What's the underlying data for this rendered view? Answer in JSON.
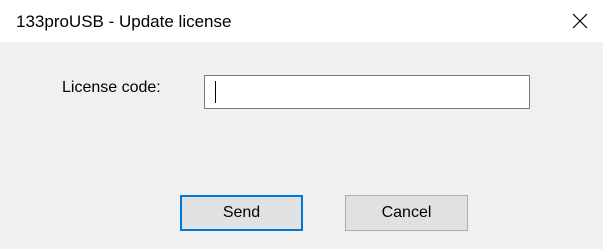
{
  "window": {
    "title": "133proUSB - Update license"
  },
  "form": {
    "license_label": "License code:",
    "license_value": "",
    "license_placeholder": ""
  },
  "buttons": {
    "send_label": "Send",
    "cancel_label": "Cancel"
  },
  "icons": {
    "close": "close-icon"
  }
}
